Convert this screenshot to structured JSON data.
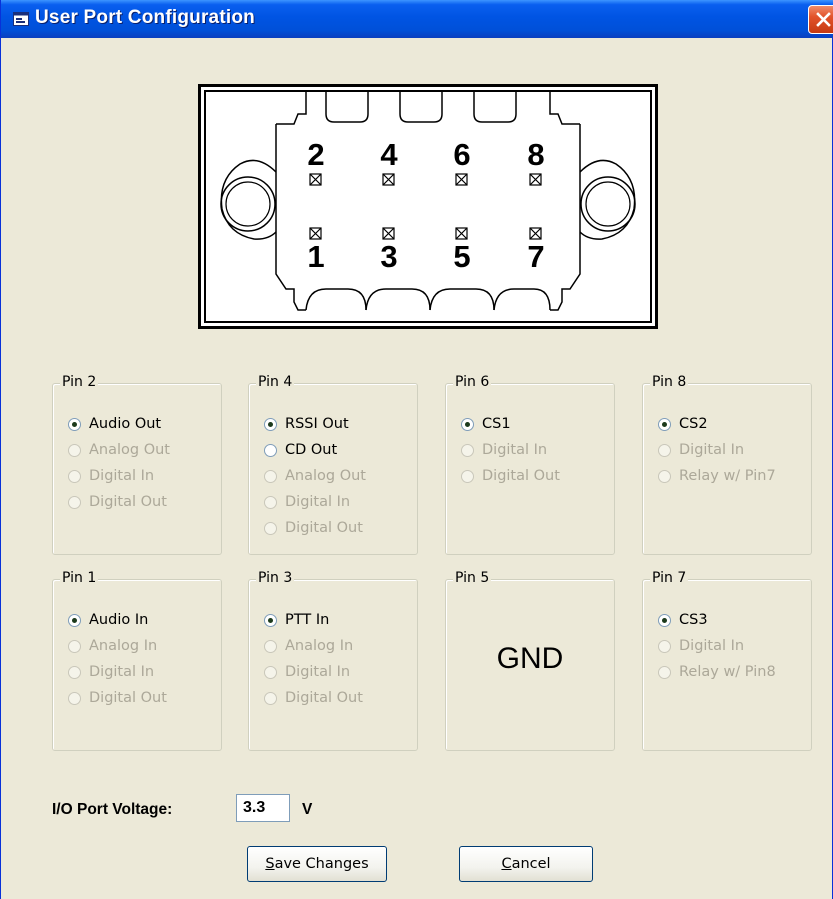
{
  "window": {
    "title": "User Port Configuration",
    "title_icon": "app-window-icon",
    "close_icon": "close-icon"
  },
  "connector": {
    "top_pins": [
      "2",
      "4",
      "6",
      "8"
    ],
    "bottom_pins": [
      "1",
      "3",
      "5",
      "7"
    ]
  },
  "groups": {
    "pin2": {
      "title": "Pin 2",
      "options": [
        {
          "label": "Audio Out",
          "enabled": true,
          "checked": true
        },
        {
          "label": "Analog Out",
          "enabled": false,
          "checked": false
        },
        {
          "label": "Digital In",
          "enabled": false,
          "checked": false
        },
        {
          "label": "Digital Out",
          "enabled": false,
          "checked": false
        }
      ]
    },
    "pin4": {
      "title": "Pin 4",
      "options": [
        {
          "label": "RSSI Out",
          "enabled": true,
          "checked": true
        },
        {
          "label": "CD Out",
          "enabled": true,
          "checked": false
        },
        {
          "label": "Analog Out",
          "enabled": false,
          "checked": false
        },
        {
          "label": "Digital In",
          "enabled": false,
          "checked": false
        },
        {
          "label": "Digital Out",
          "enabled": false,
          "checked": false
        }
      ]
    },
    "pin6": {
      "title": "Pin 6",
      "options": [
        {
          "label": "CS1",
          "enabled": true,
          "checked": true
        },
        {
          "label": "Digital In",
          "enabled": false,
          "checked": false
        },
        {
          "label": "Digital Out",
          "enabled": false,
          "checked": false
        }
      ]
    },
    "pin8": {
      "title": "Pin 8",
      "options": [
        {
          "label": "CS2",
          "enabled": true,
          "checked": true
        },
        {
          "label": "Digital In",
          "enabled": false,
          "checked": false
        },
        {
          "label": "Relay w/ Pin7",
          "enabled": false,
          "checked": false
        }
      ]
    },
    "pin1": {
      "title": "Pin 1",
      "options": [
        {
          "label": "Audio In",
          "enabled": true,
          "checked": true
        },
        {
          "label": "Analog In",
          "enabled": false,
          "checked": false
        },
        {
          "label": "Digital In",
          "enabled": false,
          "checked": false
        },
        {
          "label": "Digital Out",
          "enabled": false,
          "checked": false
        }
      ]
    },
    "pin3": {
      "title": "Pin 3",
      "options": [
        {
          "label": "PTT In",
          "enabled": true,
          "checked": true
        },
        {
          "label": "Analog In",
          "enabled": false,
          "checked": false
        },
        {
          "label": "Digital In",
          "enabled": false,
          "checked": false
        },
        {
          "label": "Digital Out",
          "enabled": false,
          "checked": false
        }
      ]
    },
    "pin5": {
      "title": "Pin 5",
      "text": "GND"
    },
    "pin7": {
      "title": "Pin 7",
      "options": [
        {
          "label": "CS3",
          "enabled": true,
          "checked": true
        },
        {
          "label": "Digital In",
          "enabled": false,
          "checked": false
        },
        {
          "label": "Relay w/ Pin8",
          "enabled": false,
          "checked": false
        }
      ]
    }
  },
  "voltage": {
    "label": "I/O Port Voltage:",
    "value": "3.3",
    "unit": "V"
  },
  "buttons": {
    "save_mnemonic": "S",
    "save_rest": "ave Changes",
    "cancel_mnemonic": "C",
    "cancel_rest": "ancel"
  }
}
